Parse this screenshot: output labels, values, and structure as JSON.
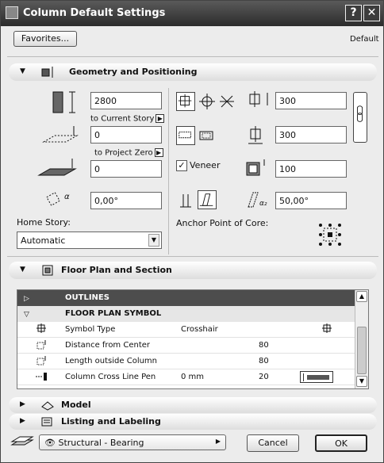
{
  "window": {
    "title": "Column Default Settings",
    "help_label": "?",
    "close_label": "✕"
  },
  "header": {
    "favorites_label": "Favorites...",
    "default_label": "Default"
  },
  "geometry": {
    "title": "Geometry and Positioning",
    "height_value": "2800",
    "to_current_story_label": "to Current Story",
    "current_story_offset": "0",
    "to_project_zero_label": "to Project Zero",
    "project_zero_offset": "0",
    "angle_value": "0,00°",
    "home_story_label": "Home Story:",
    "home_story_value": "Automatic",
    "width_value": "300",
    "depth_value": "300",
    "veneer_label": "Veneer",
    "veneer_checked": true,
    "veneer_value": "100",
    "slant_value": "50,00°",
    "anchor_label": "Anchor Point of Core:"
  },
  "floor_plan": {
    "title": "Floor Plan and Section",
    "rows": [
      {
        "label": "OUTLINES",
        "value": "",
        "value2": "",
        "style": "dark",
        "icon": "collapsed-triangle-icon"
      },
      {
        "label": "FLOOR PLAN SYMBOL",
        "value": "",
        "value2": "",
        "style": "light",
        "icon": "expanded-triangle-icon"
      },
      {
        "label": "Symbol Type",
        "value": "Crosshair",
        "value2": "",
        "style": "normal",
        "icon": "symbol-type-icon"
      },
      {
        "label": "Distance from Center",
        "value": "",
        "value2": "80",
        "style": "normal",
        "icon": "distance-icon"
      },
      {
        "label": "Length outside Column",
        "value": "",
        "value2": "80",
        "style": "normal",
        "icon": "length-icon"
      },
      {
        "label": "Column Cross Line Pen",
        "value": "0 mm",
        "value2": "20",
        "style": "normal",
        "icon": "pen-icon"
      }
    ]
  },
  "model": {
    "title": "Model"
  },
  "listing": {
    "title": "Listing and Labeling"
  },
  "footer": {
    "layer_value": "Structural - Bearing",
    "cancel_label": "Cancel",
    "ok_label": "OK"
  }
}
